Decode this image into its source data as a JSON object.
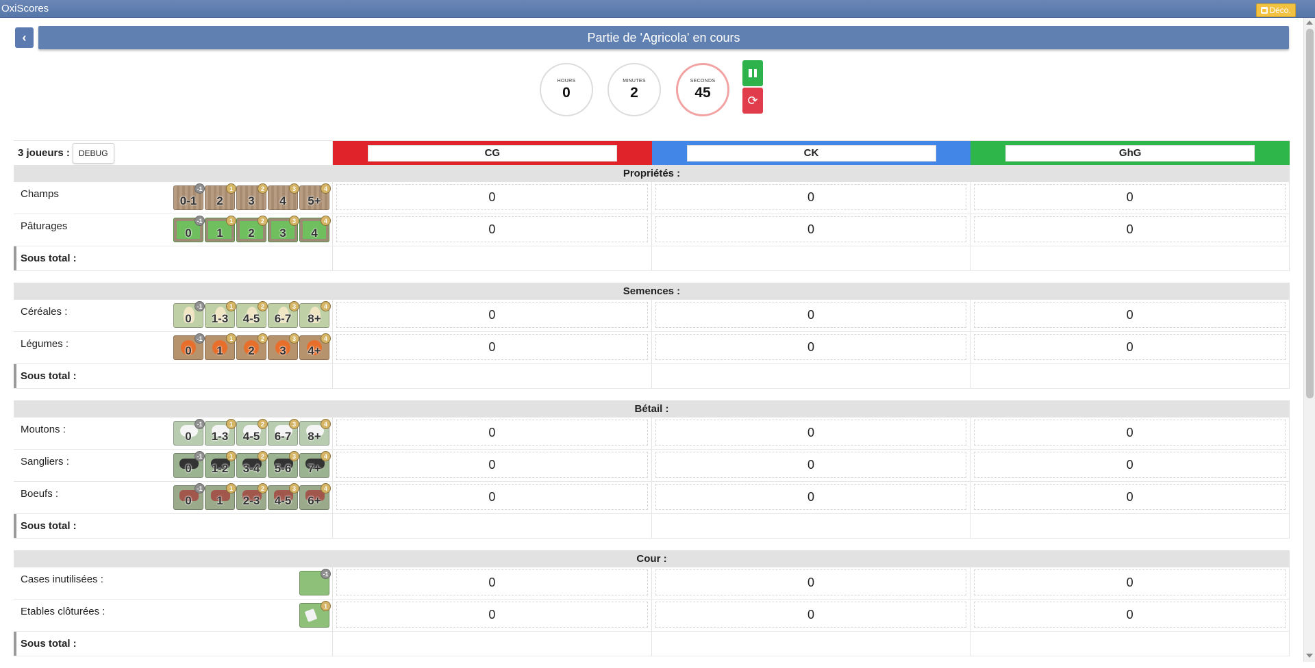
{
  "app": {
    "title": "OxiScores",
    "logout_label": "Déco."
  },
  "header": {
    "title": "Partie de 'Agricola' en cours",
    "back_glyph": "‹"
  },
  "timer": {
    "hours_label": "HOURS",
    "hours": "0",
    "minutes_label": "MINUTES",
    "minutes": "2",
    "seconds_label": "SECONDS",
    "seconds": "45",
    "pause_color": "#2eb34c",
    "reset_color": "#e03c4b"
  },
  "players": {
    "count_label": "3 joueurs :",
    "debug_label": "DEBUG",
    "list": [
      {
        "name": "CG",
        "color": "#e0222a"
      },
      {
        "name": "CK",
        "color": "#4287e8"
      },
      {
        "name": "GhG",
        "color": "#2fb64a"
      }
    ]
  },
  "sections": [
    {
      "title": "Propriétés :",
      "rows": [
        {
          "label": "Champs",
          "tile_style": "wood",
          "tiles": [
            {
              "text": "0-1",
              "badge": "-1"
            },
            {
              "text": "2",
              "badge": "1"
            },
            {
              "text": "3",
              "badge": "2"
            },
            {
              "text": "4",
              "badge": "3"
            },
            {
              "text": "5+",
              "badge": "4"
            }
          ],
          "values": [
            "0",
            "0",
            "0"
          ]
        },
        {
          "label": "Pâturages",
          "tile_style": "pasture",
          "tiles": [
            {
              "text": "0",
              "badge": "-1"
            },
            {
              "text": "1",
              "badge": "1"
            },
            {
              "text": "2",
              "badge": "2"
            },
            {
              "text": "3",
              "badge": "3"
            },
            {
              "text": "4",
              "badge": "4"
            }
          ],
          "values": [
            "0",
            "0",
            "0"
          ]
        }
      ],
      "subtotal_label": "Sous total :"
    },
    {
      "title": "Semences :",
      "rows": [
        {
          "label": "Céréales :",
          "tile_style": "grain",
          "tiles": [
            {
              "text": "0",
              "badge": "-1"
            },
            {
              "text": "1-3",
              "badge": "1"
            },
            {
              "text": "4-5",
              "badge": "2"
            },
            {
              "text": "6-7",
              "badge": "3"
            },
            {
              "text": "8+",
              "badge": "4"
            }
          ],
          "values": [
            "0",
            "0",
            "0"
          ]
        },
        {
          "label": "Légumes :",
          "tile_style": "veg",
          "tiles": [
            {
              "text": "0",
              "badge": "-1"
            },
            {
              "text": "1",
              "badge": "1"
            },
            {
              "text": "2",
              "badge": "2"
            },
            {
              "text": "3",
              "badge": "3"
            },
            {
              "text": "4+",
              "badge": "4"
            }
          ],
          "values": [
            "0",
            "0",
            "0"
          ]
        }
      ],
      "subtotal_label": "Sous total :"
    },
    {
      "title": "Bétail :",
      "rows": [
        {
          "label": "Moutons :",
          "tile_style": "sheep",
          "tiles": [
            {
              "text": "0",
              "badge": "-1"
            },
            {
              "text": "1-3",
              "badge": "1"
            },
            {
              "text": "4-5",
              "badge": "2"
            },
            {
              "text": "6-7",
              "badge": "3"
            },
            {
              "text": "8+",
              "badge": "4"
            }
          ],
          "values": [
            "0",
            "0",
            "0"
          ]
        },
        {
          "label": "Sangliers :",
          "tile_style": "boar",
          "tiles": [
            {
              "text": "0",
              "badge": "-1"
            },
            {
              "text": "1-2",
              "badge": "1"
            },
            {
              "text": "3-4",
              "badge": "2"
            },
            {
              "text": "5-6",
              "badge": "3"
            },
            {
              "text": "7+",
              "badge": "4"
            }
          ],
          "values": [
            "0",
            "0",
            "0"
          ]
        },
        {
          "label": "Boeufs :",
          "tile_style": "ox",
          "tiles": [
            {
              "text": "0",
              "badge": "-1"
            },
            {
              "text": "1",
              "badge": "1"
            },
            {
              "text": "2-3",
              "badge": "2"
            },
            {
              "text": "4-5",
              "badge": "3"
            },
            {
              "text": "6+",
              "badge": "4"
            }
          ],
          "values": [
            "0",
            "0",
            "0"
          ]
        }
      ],
      "subtotal_label": "Sous total :"
    },
    {
      "title": "Cour :",
      "rows": [
        {
          "label": "Cases inutilisées :",
          "tile_style": "yard",
          "tiles": [
            {
              "text": "",
              "badge": "-1"
            }
          ],
          "values": [
            "0",
            "0",
            "0"
          ]
        },
        {
          "label": "Etables clôturées :",
          "tile_style": "stable",
          "tiles": [
            {
              "text": "",
              "badge": "1"
            }
          ],
          "values": [
            "0",
            "0",
            "0"
          ]
        }
      ],
      "subtotal_label": "Sous total :"
    }
  ]
}
